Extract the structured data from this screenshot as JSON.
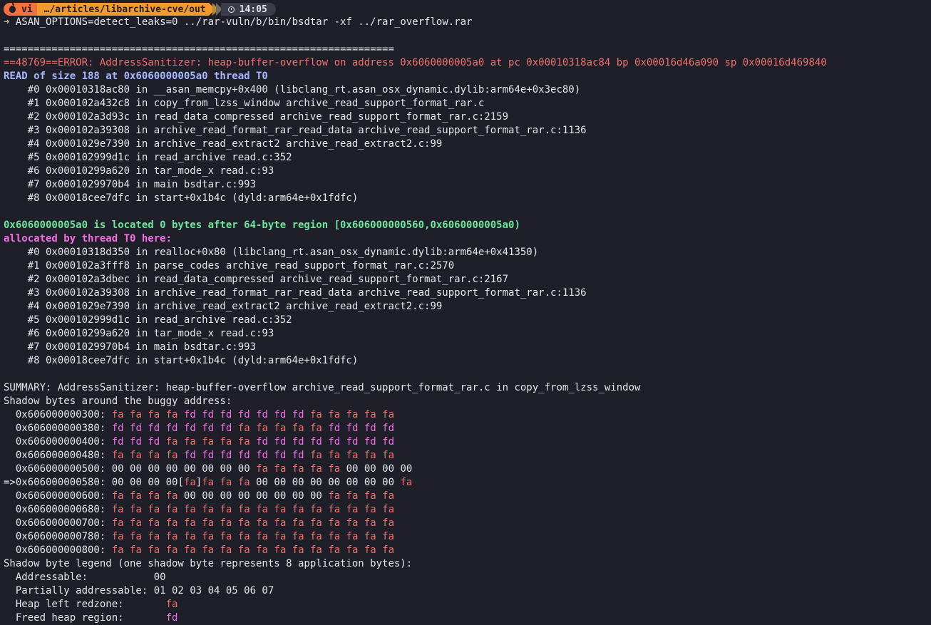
{
  "prompt": {
    "shell": "vi",
    "path": "…/articles/libarchive-cve/out",
    "time": "14:05",
    "arrow": "➜",
    "command": "ASAN_OPTIONS=detect_leaks=0 ../rar-vuln/b/bin/bsdtar -xf ../rar_overflow.rar"
  },
  "separator": "=================================================================",
  "error_line": "==48769==ERROR: AddressSanitizer: heap-buffer-overflow on address 0x6060000005a0 at pc 0x00010318ac84 bp 0x00016d46a090 sp 0x00016d469840",
  "read_line": "READ of size 188 at 0x6060000005a0 thread T0",
  "read_stack": [
    "    #0 0x00010318ac80 in __asan_memcpy+0x400 (libclang_rt.asan_osx_dynamic.dylib:arm64e+0x3ec80)",
    "    #1 0x000102a432c8 in copy_from_lzss_window archive_read_support_format_rar.c",
    "    #2 0x000102a3d93c in read_data_compressed archive_read_support_format_rar.c:2159",
    "    #3 0x000102a39308 in archive_read_format_rar_read_data archive_read_support_format_rar.c:1136",
    "    #4 0x0001029e7390 in archive_read_extract2 archive_read_extract2.c:99",
    "    #5 0x000102999d1c in read_archive read.c:352",
    "    #6 0x00010299a620 in tar_mode_x read.c:93",
    "    #7 0x0001029970b4 in main bsdtar.c:993",
    "    #8 0x00018cee7dfc in start+0x1b4c (dyld:arm64e+0x1fdfc)"
  ],
  "located_line": "0x6060000005a0 is located 0 bytes after 64-byte region [0x606000000560,0x6060000005a0)",
  "allocated_line": "allocated by thread T0 here:",
  "alloc_stack": [
    "    #0 0x00010318d350 in realloc+0x80 (libclang_rt.asan_osx_dynamic.dylib:arm64e+0x41350)",
    "    #1 0x000102a3fff8 in parse_codes archive_read_support_format_rar.c:2570",
    "    #2 0x000102a3dbec in read_data_compressed archive_read_support_format_rar.c:2167",
    "    #3 0x000102a39308 in archive_read_format_rar_read_data archive_read_support_format_rar.c:1136",
    "    #4 0x0001029e7390 in archive_read_extract2 archive_read_extract2.c:99",
    "    #5 0x000102999d1c in read_archive read.c:352",
    "    #6 0x00010299a620 in tar_mode_x read.c:93",
    "    #7 0x0001029970b4 in main bsdtar.c:993",
    "    #8 0x00018cee7dfc in start+0x1b4c (dyld:arm64e+0x1fdfc)"
  ],
  "summary_line": "SUMMARY: AddressSanitizer: heap-buffer-overflow archive_read_support_format_rar.c in copy_from_lzss_window",
  "shadow_header": "Shadow bytes around the buggy address:",
  "shadow_rows": [
    {
      "prefix": "  ",
      "addr": "0x606000000300:",
      "bytes": [
        "fa",
        "fa",
        "fa",
        "fa",
        "fd",
        "fd",
        "fd",
        "fd",
        "fd",
        "fd",
        "fd",
        "fa",
        "fa",
        "fa",
        "fa",
        "fa"
      ]
    },
    {
      "prefix": "  ",
      "addr": "0x606000000380:",
      "bytes": [
        "fd",
        "fd",
        "fd",
        "fd",
        "fd",
        "fd",
        "fd",
        "fa",
        "fa",
        "fa",
        "fa",
        "fa",
        "fd",
        "fd",
        "fd",
        "fd"
      ]
    },
    {
      "prefix": "  ",
      "addr": "0x606000000400:",
      "bytes": [
        "fd",
        "fd",
        "fd",
        "fa",
        "fa",
        "fa",
        "fa",
        "fa",
        "fd",
        "fd",
        "fd",
        "fd",
        "fd",
        "fd",
        "fd",
        "fd"
      ]
    },
    {
      "prefix": "  ",
      "addr": "0x606000000480:",
      "bytes": [
        "fa",
        "fa",
        "fa",
        "fa",
        "fd",
        "fd",
        "fd",
        "fd",
        "fd",
        "fd",
        "fd",
        "fa",
        "fa",
        "fa",
        "fa",
        "fa"
      ]
    },
    {
      "prefix": "  ",
      "addr": "0x606000000500:",
      "bytes": [
        "00",
        "00",
        "00",
        "00",
        "00",
        "00",
        "00",
        "00",
        "fa",
        "fa",
        "fa",
        "fa",
        "fa",
        "00",
        "00",
        "00",
        "00"
      ]
    },
    {
      "prefix": "=>",
      "addr": "0x606000000580:",
      "bytes": [
        "00",
        "00",
        "00",
        "00",
        "[fa]",
        "fa",
        "fa",
        "fa",
        "00",
        "00",
        "00",
        "00",
        "00",
        "00",
        "00",
        "00",
        "fa"
      ]
    },
    {
      "prefix": "  ",
      "addr": "0x606000000600:",
      "bytes": [
        "fa",
        "fa",
        "fa",
        "fa",
        "00",
        "00",
        "00",
        "00",
        "00",
        "00",
        "00",
        "00",
        "fa",
        "fa",
        "fa",
        "fa"
      ]
    },
    {
      "prefix": "  ",
      "addr": "0x606000000680:",
      "bytes": [
        "fa",
        "fa",
        "fa",
        "fa",
        "fa",
        "fa",
        "fa",
        "fa",
        "fa",
        "fa",
        "fa",
        "fa",
        "fa",
        "fa",
        "fa",
        "fa"
      ]
    },
    {
      "prefix": "  ",
      "addr": "0x606000000700:",
      "bytes": [
        "fa",
        "fa",
        "fa",
        "fa",
        "fa",
        "fa",
        "fa",
        "fa",
        "fa",
        "fa",
        "fa",
        "fa",
        "fa",
        "fa",
        "fa",
        "fa"
      ]
    },
    {
      "prefix": "  ",
      "addr": "0x606000000780:",
      "bytes": [
        "fa",
        "fa",
        "fa",
        "fa",
        "fa",
        "fa",
        "fa",
        "fa",
        "fa",
        "fa",
        "fa",
        "fa",
        "fa",
        "fa",
        "fa",
        "fa"
      ]
    },
    {
      "prefix": "  ",
      "addr": "0x606000000800:",
      "bytes": [
        "fa",
        "fa",
        "fa",
        "fa",
        "fa",
        "fa",
        "fa",
        "fa",
        "fa",
        "fa",
        "fa",
        "fa",
        "fa",
        "fa",
        "fa",
        "fa"
      ]
    }
  ],
  "legend_header": "Shadow byte legend (one shadow byte represents 8 application bytes):",
  "legend": [
    {
      "label": "  Addressable:           ",
      "value": "00",
      "kind": "plain"
    },
    {
      "label": "  Partially addressable: ",
      "value": "01 02 03 04 05 06 07",
      "kind": "plain"
    },
    {
      "label": "  Heap left redzone:       ",
      "value": "fa",
      "kind": "fa"
    },
    {
      "label": "  Freed heap region:       ",
      "value": "fd",
      "kind": "fd"
    }
  ],
  "colors": {
    "background": "#1e1f29",
    "error": "#f0716b",
    "thread": "#a6b6ff",
    "located": "#6ee59a",
    "allocated": "#f56fe6"
  }
}
